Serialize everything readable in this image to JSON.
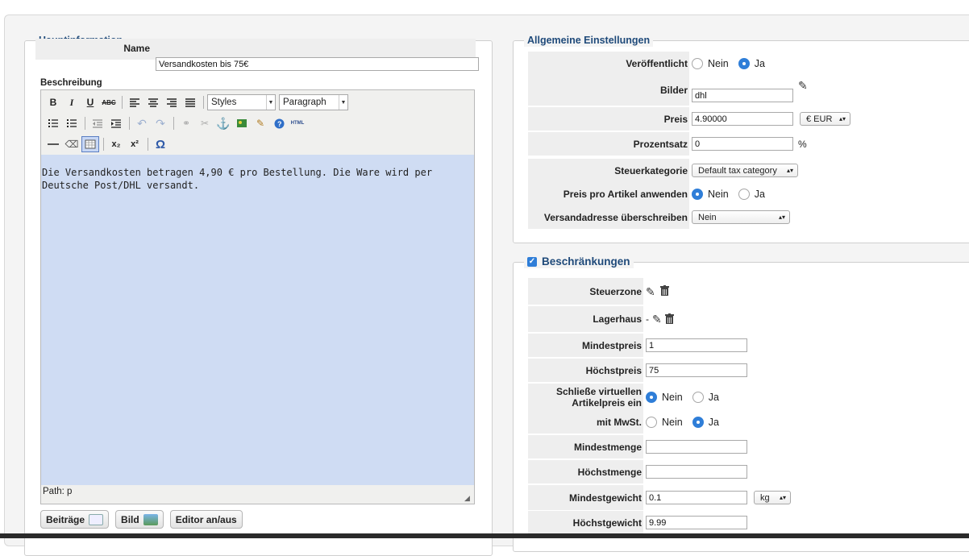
{
  "main_info": {
    "legend": "Hauptinformation",
    "name_label": "Name",
    "name_value": "Versandkosten bis 75€",
    "description_label": "Beschreibung",
    "editor": {
      "toolbar": {
        "bold": "B",
        "italic": "I",
        "underline": "U",
        "strike": "ABC",
        "styles_select": "Styles",
        "format_select": "Paragraph",
        "html_label": "HTML",
        "subscript": "x₂",
        "superscript": "x²",
        "omega": "Ω"
      },
      "content": "Die Versandkosten betragen 4,90 € pro Bestellung. Die Ware wird per Deutsche Post/DHL versandt.",
      "path": "Path: p"
    },
    "buttons": {
      "articles": "Beiträge",
      "image": "Bild",
      "toggle_editor": "Editor an/aus"
    }
  },
  "general": {
    "legend": "Allgemeine Einstellungen",
    "published_label": "Veröffentlicht",
    "no": "Nein",
    "yes": "Ja",
    "images_label": "Bilder",
    "images_value": "dhl",
    "price_label": "Preis",
    "price_value": "4.90000",
    "currency": "€ EUR",
    "percentage_label": "Prozentsatz",
    "percentage_value": "0",
    "percent_sign": "%",
    "tax_category_label": "Steuerkategorie",
    "tax_category_value": "Default tax category",
    "price_per_item_label": "Preis pro Artikel anwenden",
    "override_address_label": "Versandadresse überschreiben",
    "override_address_value": "Nein"
  },
  "restrictions": {
    "legend": "Beschränkungen",
    "tax_zone_label": "Steuerzone",
    "warehouse_label": "Lagerhaus",
    "warehouse_value": "-",
    "min_price_label": "Mindestpreis",
    "min_price_value": "1",
    "max_price_label": "Höchstpreis",
    "max_price_value": "75",
    "virtual_label": "Schließe virtuellen Artikelpreis ein",
    "vat_label": "mit MwSt.",
    "min_qty_label": "Mindestmenge",
    "min_qty_value": "",
    "max_qty_label": "Höchstmenge",
    "max_qty_value": "",
    "min_weight_label": "Mindestgewicht",
    "min_weight_value": "0.1",
    "weight_unit": "kg",
    "max_weight_label": "Höchstgewicht",
    "max_weight_value": "9.99",
    "no": "Nein",
    "yes": "Ja"
  },
  "colors": {
    "legend_text": "#1f4a7a",
    "radio_selected": "#2f7ed8",
    "editor_bg": "#cfdcf3"
  },
  "icons": [
    "pencil-icon",
    "trash-icon",
    "anchor-icon",
    "help-icon",
    "checkbox-icon"
  ]
}
